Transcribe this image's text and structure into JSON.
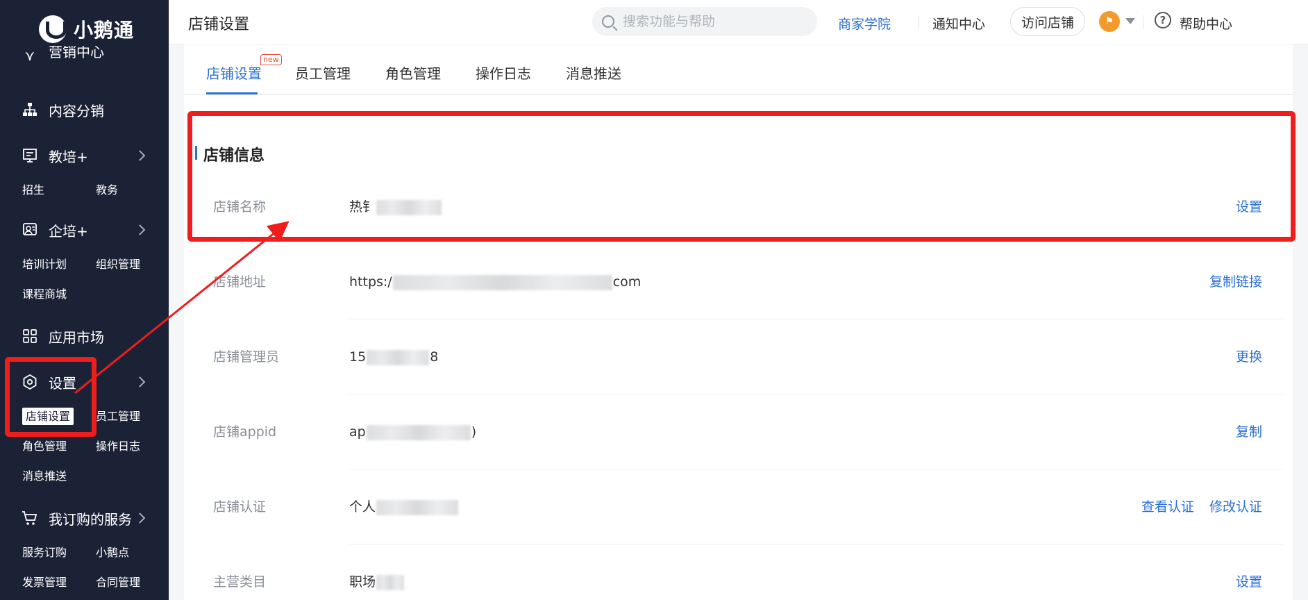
{
  "logo": {
    "text": "小鹅通"
  },
  "sidebar": {
    "partial_top": "营销中心",
    "sections": [
      {
        "label": "内容分销",
        "icon": "org-tree-icon",
        "has_chevron": false,
        "subs": []
      },
      {
        "label": "教培+",
        "icon": "classroom-icon",
        "has_chevron": true,
        "subs": [
          "招生",
          "教务"
        ]
      },
      {
        "label": "企培+",
        "icon": "team-training-icon",
        "has_chevron": true,
        "subs": [
          "培训计划",
          "组织管理",
          "课程商城"
        ]
      },
      {
        "label": "应用市场",
        "icon": "apps-grid-icon",
        "has_chevron": false,
        "subs": []
      },
      {
        "label": "设置",
        "icon": "settings-hexagon-icon",
        "has_chevron": true,
        "subs": [
          "店铺设置",
          "员工管理",
          "角色管理",
          "操作日志",
          "消息推送"
        ],
        "active_sub": "店铺设置"
      },
      {
        "label": "我订购的服务",
        "icon": "cart-icon",
        "has_chevron": true,
        "subs": [
          "服务订购",
          "小鹅点",
          "发票管理",
          "合同管理"
        ]
      }
    ]
  },
  "topbar": {
    "title": "店铺设置",
    "search_placeholder": "搜索功能与帮助",
    "link_academy": "商家学院",
    "link_notify": "通知中心",
    "visit_store": "访问店铺",
    "help": "帮助中心"
  },
  "tabs": {
    "items": [
      "店铺设置",
      "员工管理",
      "角色管理",
      "操作日志",
      "消息推送"
    ],
    "active": 0,
    "new_badge": "new"
  },
  "store_info": {
    "title": "店铺信息",
    "rows": [
      {
        "label": "店铺名称",
        "value_prefix": "热钅",
        "value_suffix": "",
        "actions": [
          "设置"
        ]
      },
      {
        "label": "店铺地址",
        "value_prefix": "https:/",
        "value_suffix": "com",
        "actions": [
          "复制链接"
        ]
      },
      {
        "label": "店铺管理员",
        "value_prefix": "15",
        "value_suffix": "8",
        "actions": [
          "更换"
        ]
      },
      {
        "label": "店铺appid",
        "value_prefix": "ap",
        "value_suffix": ")",
        "actions": [
          "复制"
        ]
      },
      {
        "label": "店铺认证",
        "value_prefix": "个人",
        "value_suffix": "",
        "actions": [
          "查看认证",
          "修改认证"
        ]
      },
      {
        "label": "主营类目",
        "value_prefix": "职场",
        "value_suffix": "",
        "actions": [
          "设置"
        ]
      }
    ]
  },
  "colors": {
    "sidebar_bg": "#1b2236",
    "accent": "#2c6fd6",
    "annotation": "#f01d1d"
  }
}
